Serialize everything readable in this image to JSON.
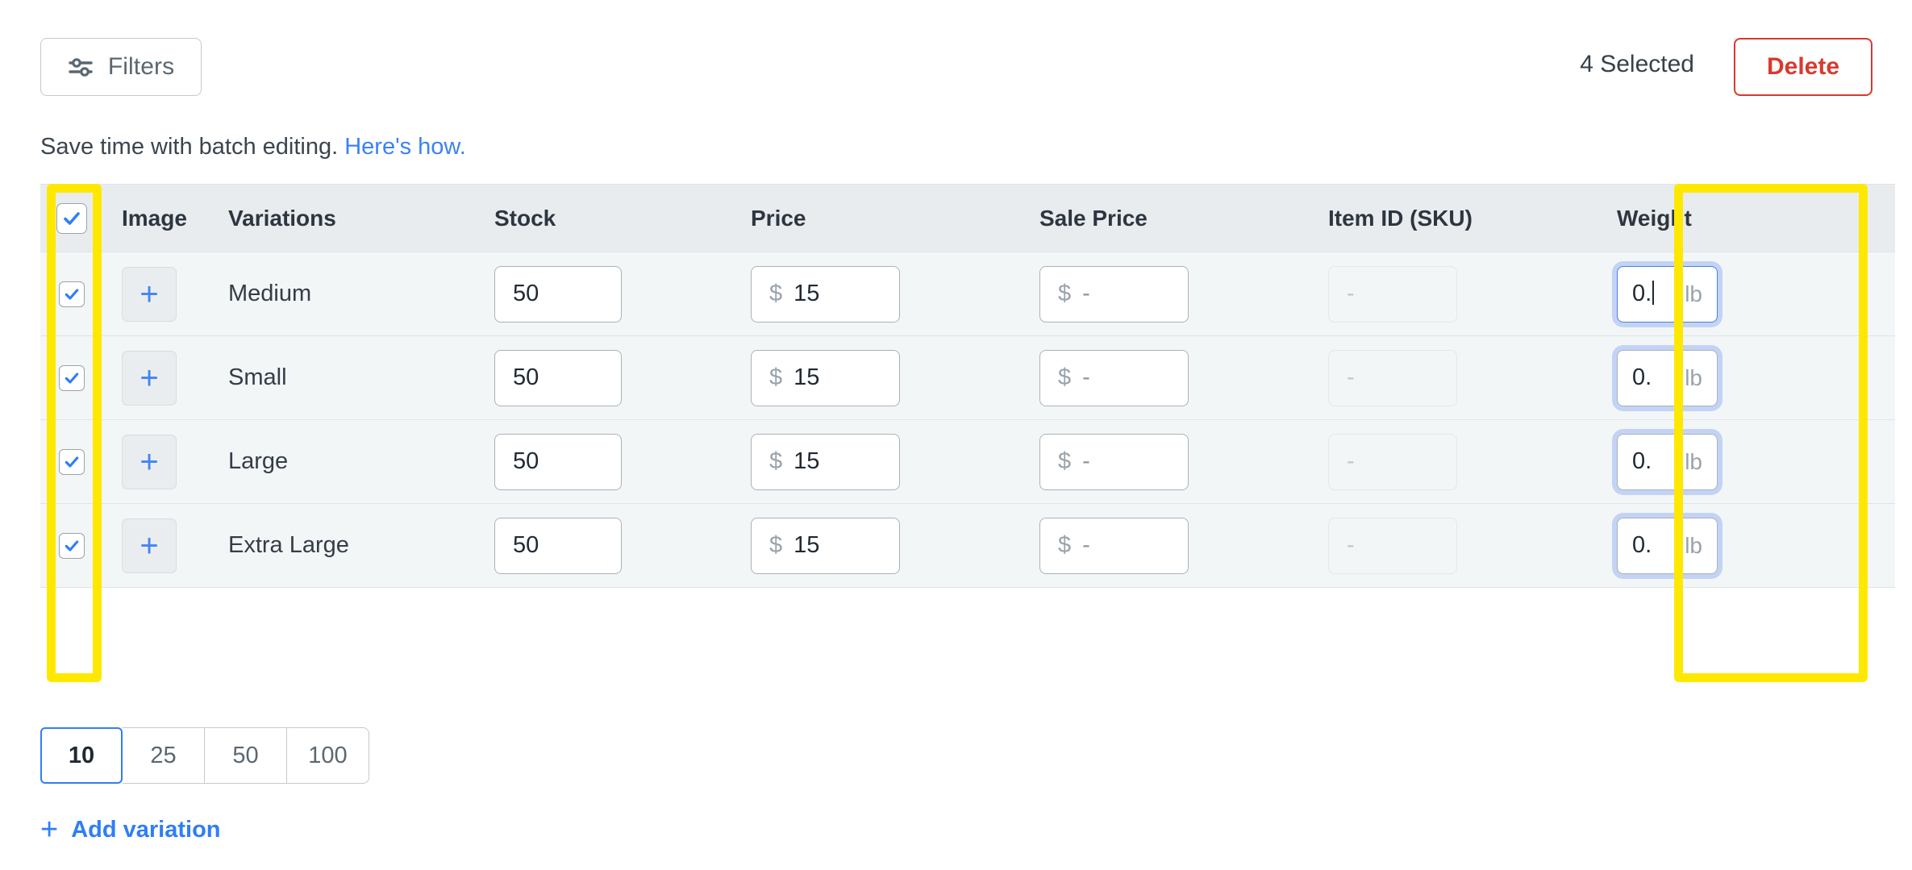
{
  "toolbar": {
    "filters_label": "Filters",
    "filters_icon": "sliders-icon",
    "selected_count_label": "4 Selected",
    "delete_label": "Delete"
  },
  "batch_note": {
    "text": "Save time with batch editing.",
    "link_text": "Here's how."
  },
  "table": {
    "columns": [
      "Image",
      "Variations",
      "Stock",
      "Price",
      "Sale Price",
      "Item ID (SKU)",
      "Weight"
    ],
    "header_checkbox_checked": true,
    "rows": [
      {
        "checked": true,
        "image_action": "+",
        "variation": "Medium",
        "stock": "50",
        "price_prefix": "$",
        "price": "15",
        "sale_prefix": "$",
        "sale_price": "-",
        "sku": "-",
        "weight": "0.",
        "weight_unit": "lb",
        "weight_focused": true
      },
      {
        "checked": true,
        "image_action": "+",
        "variation": "Small",
        "stock": "50",
        "price_prefix": "$",
        "price": "15",
        "sale_prefix": "$",
        "sale_price": "-",
        "sku": "-",
        "weight": "0.",
        "weight_unit": "lb",
        "weight_focused": false
      },
      {
        "checked": true,
        "image_action": "+",
        "variation": "Large",
        "stock": "50",
        "price_prefix": "$",
        "price": "15",
        "sale_prefix": "$",
        "sale_price": "-",
        "sku": "-",
        "weight": "0.",
        "weight_unit": "lb",
        "weight_focused": false
      },
      {
        "checked": true,
        "image_action": "+",
        "variation": "Extra Large",
        "stock": "50",
        "price_prefix": "$",
        "price": "15",
        "sale_prefix": "$",
        "sale_price": "-",
        "sku": "-",
        "weight": "0.",
        "weight_unit": "lb",
        "weight_focused": false
      }
    ]
  },
  "pagination": {
    "options": [
      "10",
      "25",
      "50",
      "100"
    ],
    "selected": "10"
  },
  "add_variation": {
    "plus": "+",
    "label": "Add variation"
  },
  "highlights": {
    "left_label": "select-column-highlight",
    "right_label": "weight-column-highlight",
    "color": "#ffe800"
  },
  "colors": {
    "accent_blue": "#2f7ef5",
    "delete_red": "#d63b2f",
    "header_bg": "#e9ecee",
    "row_bg": "#f3f6f7",
    "highlight_yellow": "#ffe800"
  }
}
